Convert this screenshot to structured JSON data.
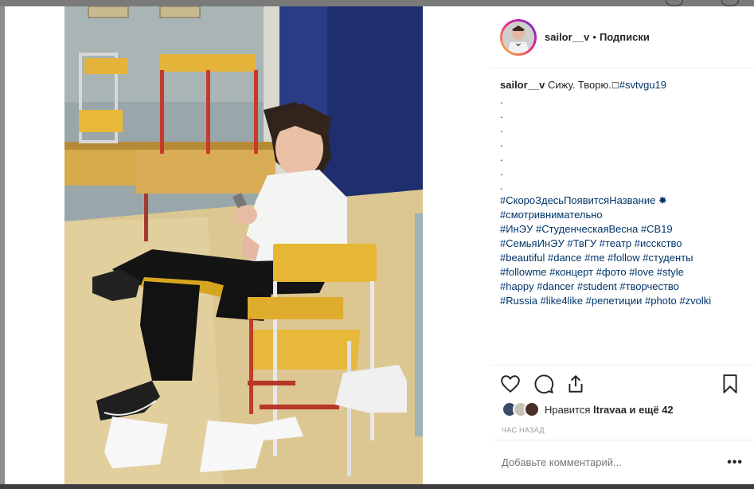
{
  "post": {
    "username": "sailor__v",
    "separator": "•",
    "follow_label": "Подписки",
    "caption_user": "sailor__v",
    "caption_text": "Сижу. Творю.",
    "caption_tag": "#svtvgu19",
    "caption_dots": [
      ".",
      ".",
      ".",
      ".",
      ".",
      ".",
      "."
    ],
    "hashtag_lines": [
      "#СкороЗдесьПоявитсяНазвание ✸",
      "#смотривнимательно",
      "#ИнЭУ #СтуденческаяВесна #СВ19",
      "#СемьяИнЭУ #ТвГУ #театр #исскство",
      "#beautiful #dance #me #follow #студенты",
      "#followme #концерт #фото #love #style",
      "#happy #dancer #student #творчество",
      "#Russia #like4like #репетиции #photo #zvolki"
    ],
    "likes_prefix": "Нравится",
    "likes_user": "ltravaa",
    "likes_suffix": "и ещё 42",
    "time_label": "ЧАС НАЗАД",
    "comment_placeholder": "Добавьте комментарий...",
    "more_label": "•••"
  },
  "icons": {
    "like": "heart-icon",
    "comment": "comment-icon",
    "share": "share-icon",
    "save": "bookmark-icon"
  },
  "colors": {
    "hashtag": "#003569",
    "text": "#262626",
    "muted": "#999999"
  }
}
